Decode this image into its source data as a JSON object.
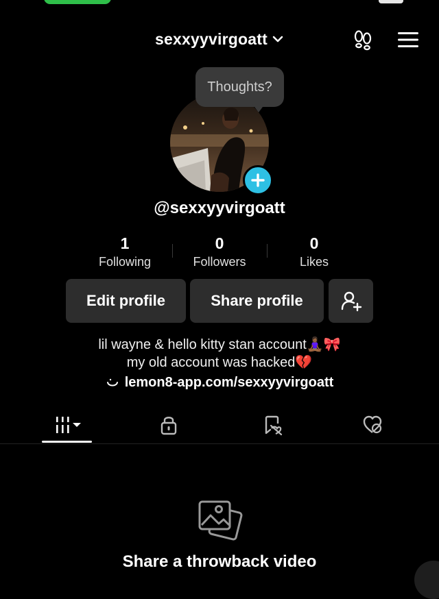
{
  "header": {
    "username": "sexxyyvirgoatt"
  },
  "bubble": {
    "text": "Thoughts?"
  },
  "profile": {
    "handle": "@sexxyyvirgoatt"
  },
  "stats": [
    {
      "value": "1",
      "label": "Following"
    },
    {
      "value": "0",
      "label": "Followers"
    },
    {
      "value": "0",
      "label": "Likes"
    }
  ],
  "buttons": {
    "edit": "Edit profile",
    "share": "Share profile"
  },
  "bio": {
    "line1": "lil wayne & hello kitty stan account🧘🏾‍♀️🎀",
    "line2": "my old account was hacked💔",
    "link": "lemon8-app.com/sexxyyvirgoatt"
  },
  "empty_state": {
    "text": "Share a throwback video"
  },
  "colors": {
    "background": "#000000",
    "button": "#2d2d2d",
    "accent": "#2ec0e4",
    "bubble": "#3a3a3a"
  },
  "icons": [
    "chevron-down-icon",
    "footsteps-icon",
    "menu-icon",
    "plus-icon",
    "add-friend-icon",
    "lemon8-icon",
    "grid-icon",
    "lock-icon",
    "repost-icon",
    "liked-icon",
    "photo-stack-icon"
  ]
}
